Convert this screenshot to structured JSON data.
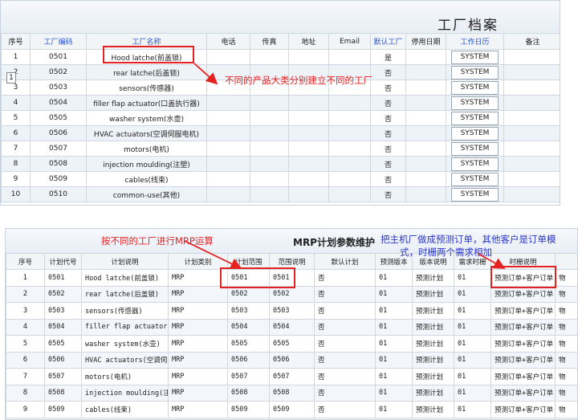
{
  "top": {
    "title": "工厂档案",
    "columns": [
      "序号",
      "工厂编码",
      "工厂名称",
      "电话",
      "传真",
      "地址",
      "Email",
      "默认工厂",
      "停用日期",
      "工作日历",
      "备注"
    ],
    "rows": [
      {
        "no": "1",
        "code": "0501",
        "name": "Hood latche(前盖锁)",
        "default": "是",
        "calendar": "SYSTEM"
      },
      {
        "no": "2",
        "code": "0502",
        "name": "rear latche(后盖锁)",
        "default": "否",
        "calendar": "SYSTEM"
      },
      {
        "no": "3",
        "code": "0503",
        "name": "sensors(传感器)",
        "default": "否",
        "calendar": "SYSTEM"
      },
      {
        "no": "4",
        "code": "0504",
        "name": "filler flap actuator(口盖执行器)",
        "default": "否",
        "calendar": "SYSTEM"
      },
      {
        "no": "5",
        "code": "0505",
        "name": "washer system(水壶)",
        "default": "否",
        "calendar": "SYSTEM"
      },
      {
        "no": "6",
        "code": "0506",
        "name": "HVAC actuators(空调伺服电机)",
        "default": "否",
        "calendar": "SYSTEM"
      },
      {
        "no": "7",
        "code": "0507",
        "name": "motors(电机)",
        "default": "否",
        "calendar": "SYSTEM"
      },
      {
        "no": "8",
        "code": "0508",
        "name": "injection moulding(注塑)",
        "default": "否",
        "calendar": "SYSTEM"
      },
      {
        "no": "9",
        "code": "0509",
        "name": "cables(线束)",
        "default": "否",
        "calendar": "SYSTEM"
      },
      {
        "no": "10",
        "code": "0510",
        "name": "common-use(其他)",
        "default": "否",
        "calendar": "SYSTEM"
      }
    ],
    "row_marker": "1"
  },
  "bottom": {
    "title": "MRP计划参数维护",
    "columns": [
      "序号",
      "计划代号",
      "计划说明",
      "计划类别",
      "计划范围",
      "范围说明",
      "默认计划",
      "预测版本",
      "版本说明",
      "需求时栅",
      "时栅说明",
      "物"
    ],
    "rows": [
      {
        "no": "1",
        "code": "0501",
        "desc": "Hood latche(前盖锁)",
        "type": "MRP",
        "range": "0501",
        "range_desc": "0501",
        "default": "否",
        "ver": "01",
        "ver_desc": "预测计划",
        "fence": "01",
        "fence_desc": "预测订单+客户订单",
        "extra": "物"
      },
      {
        "no": "2",
        "code": "0502",
        "desc": "rear latche(后盖锁)",
        "type": "MRP",
        "range": "0502",
        "range_desc": "0502",
        "default": "否",
        "ver": "01",
        "ver_desc": "预测计划",
        "fence": "01",
        "fence_desc": "预测订单+客户订单",
        "extra": "物"
      },
      {
        "no": "3",
        "code": "0503",
        "desc": "sensors(传感器)",
        "type": "MRP",
        "range": "0503",
        "range_desc": "0503",
        "default": "否",
        "ver": "01",
        "ver_desc": "预测计划",
        "fence": "01",
        "fence_desc": "预测订单+客户订单",
        "extra": "物"
      },
      {
        "no": "4",
        "code": "0504",
        "desc": "filler flap actuator(...",
        "type": "MRP",
        "range": "0504",
        "range_desc": "0504",
        "default": "否",
        "ver": "01",
        "ver_desc": "预测计划",
        "fence": "01",
        "fence_desc": "预测订单+客户订单",
        "extra": "物"
      },
      {
        "no": "5",
        "code": "0505",
        "desc": "washer system(水壶)",
        "type": "MRP",
        "range": "0505",
        "range_desc": "0505",
        "default": "否",
        "ver": "01",
        "ver_desc": "预测计划",
        "fence": "01",
        "fence_desc": "预测订单+客户订单",
        "extra": "物"
      },
      {
        "no": "6",
        "code": "0506",
        "desc": "HVAC actuators(空调伺...",
        "type": "MRP",
        "range": "0506",
        "range_desc": "0506",
        "default": "否",
        "ver": "01",
        "ver_desc": "预测计划",
        "fence": "01",
        "fence_desc": "预测订单+客户订单",
        "extra": "物"
      },
      {
        "no": "7",
        "code": "0507",
        "desc": "motors(电机)",
        "type": "MRP",
        "range": "0507",
        "range_desc": "0507",
        "default": "否",
        "ver": "01",
        "ver_desc": "预测计划",
        "fence": "01",
        "fence_desc": "预测订单+客户订单",
        "extra": "物"
      },
      {
        "no": "8",
        "code": "0508",
        "desc": "injection moulding(注塑)",
        "type": "MRP",
        "range": "0508",
        "range_desc": "0508",
        "default": "否",
        "ver": "01",
        "ver_desc": "预测计划",
        "fence": "01",
        "fence_desc": "预测订单+客户订单",
        "extra": "物"
      },
      {
        "no": "9",
        "code": "0509",
        "desc": "cables(线束)",
        "type": "MRP",
        "range": "0509",
        "range_desc": "0509",
        "default": "否",
        "ver": "01",
        "ver_desc": "预测计划",
        "fence": "01",
        "fence_desc": "预测订单+客户订单",
        "extra": "物"
      }
    ]
  },
  "annotations": {
    "factory_note": "不同的产品大类分别建立不同的工厂",
    "mrp_note": "按不同的工厂进行MRP运算",
    "forecast_note_line1": "把主机厂做成预测订单，其他客户是订单模",
    "forecast_note_line2": "式，时栅两个需求相加"
  },
  "colors": {
    "annotation_red": "#e52222",
    "annotation_blue": "#2a35c8",
    "header_link_blue": "#2a55c8"
  }
}
